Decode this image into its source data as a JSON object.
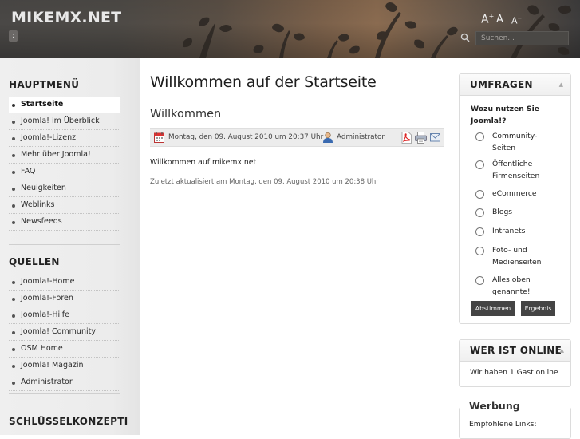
{
  "header": {
    "site_name": "MIKEMX.NET",
    "skip_label": ":",
    "fontsize": {
      "increase": "A+",
      "reset": "A",
      "decrease": "A−"
    },
    "search_placeholder": "Suchen..."
  },
  "left": {
    "hauptmenu": {
      "title": "HAUPTMENÜ",
      "items": [
        "Startseite",
        "Joomla! im Überblick",
        "Joomla!-Lizenz",
        "Mehr über Joomla!",
        "FAQ",
        "Neuigkeiten",
        "Weblinks",
        "Newsfeeds"
      ],
      "active_index": 0
    },
    "quellen": {
      "title": "QUELLEN",
      "items": [
        "Joomla!-Home",
        "Joomla!-Foren",
        "Joomla!-Hilfe",
        "Joomla! Community",
        "OSM Home",
        "Joomla! Magazin",
        "Administrator"
      ]
    },
    "schluessel": {
      "title": "SCHLÜSSELKONZEPTI"
    }
  },
  "main": {
    "page_title": "Willkommen auf der Startseite",
    "article_title": "Willkommen",
    "date": "Montag, den 09. August 2010 um 20:37 Uhr",
    "author": "Administrator",
    "text": "Willkommen auf mikemx.net",
    "modified": "Zuletzt aktualisiert am Montag, den 09. August 2010 um 20:38 Uhr",
    "icons": [
      "calendar-icon",
      "user-icon",
      "pdf-icon",
      "print-icon",
      "email-icon"
    ]
  },
  "right": {
    "umfragen": {
      "title": "UMFRAGEN",
      "question": "Wozu nutzen Sie Joomla!?",
      "options": [
        [
          "Community-",
          "Seiten"
        ],
        [
          "Öffentliche",
          "Firmenseiten"
        ],
        [
          "eCommerce"
        ],
        [
          "Blogs"
        ],
        [
          "Intranets"
        ],
        [
          "Foto- und",
          "Medienseiten"
        ],
        [
          "Alles oben",
          "genannte!"
        ]
      ],
      "vote_label": "Abstimmen",
      "results_label": "Ergebnis"
    },
    "online": {
      "title": "WER IST ONLINE",
      "text": "Wir haben 1 Gast online"
    },
    "werbung": {
      "title": "Werbung",
      "text": "Empfohlene Links:"
    }
  }
}
